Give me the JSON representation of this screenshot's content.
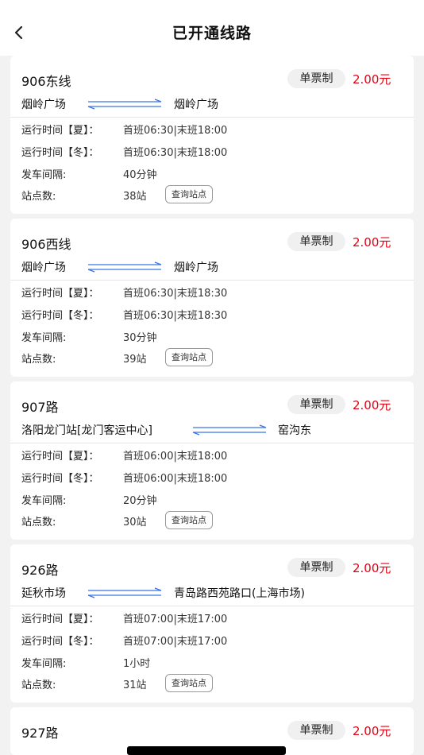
{
  "header": {
    "title": "已开通线路",
    "back_icon": "chevron-left-icon"
  },
  "labels": {
    "summer": "运行时间【夏】：",
    "winter": "运行时间【冬】：",
    "interval": "发车间隔:",
    "stops": "站点数:",
    "query_button": "查询站点",
    "ticket": "单票制"
  },
  "colors": {
    "fare": "#e60012",
    "arrow": "#3b74e8"
  },
  "routes": [
    {
      "name": "906东线",
      "fare": "2.00元",
      "origin": "烟岭广场",
      "destination": "烟岭广场",
      "summer": "首班06:30|末班18:00",
      "winter": "首班06:30|末班18:00",
      "interval": "40分钟",
      "stops": "38站"
    },
    {
      "name": "906西线",
      "fare": "2.00元",
      "origin": "烟岭广场",
      "destination": "烟岭广场",
      "summer": "首班06:30|末班18:30",
      "winter": "首班06:30|末班18:30",
      "interval": "30分钟",
      "stops": "39站"
    },
    {
      "name": "907路",
      "fare": "2.00元",
      "origin": "洛阳龙门站[龙门客运中心]",
      "destination": "窑沟东",
      "summer": "首班06:00|末班18:00",
      "winter": "首班06:00|末班18:00",
      "interval": "20分钟",
      "stops": "30站"
    },
    {
      "name": "926路",
      "fare": "2.00元",
      "origin": "延秋市场",
      "destination": "青岛路西苑路口(上海市场)",
      "summer": "首班07:00|末班17:00",
      "winter": "首班07:00|末班17:00",
      "interval": "1小时",
      "stops": "31站"
    },
    {
      "name": "927路",
      "fare": "2.00元"
    }
  ]
}
